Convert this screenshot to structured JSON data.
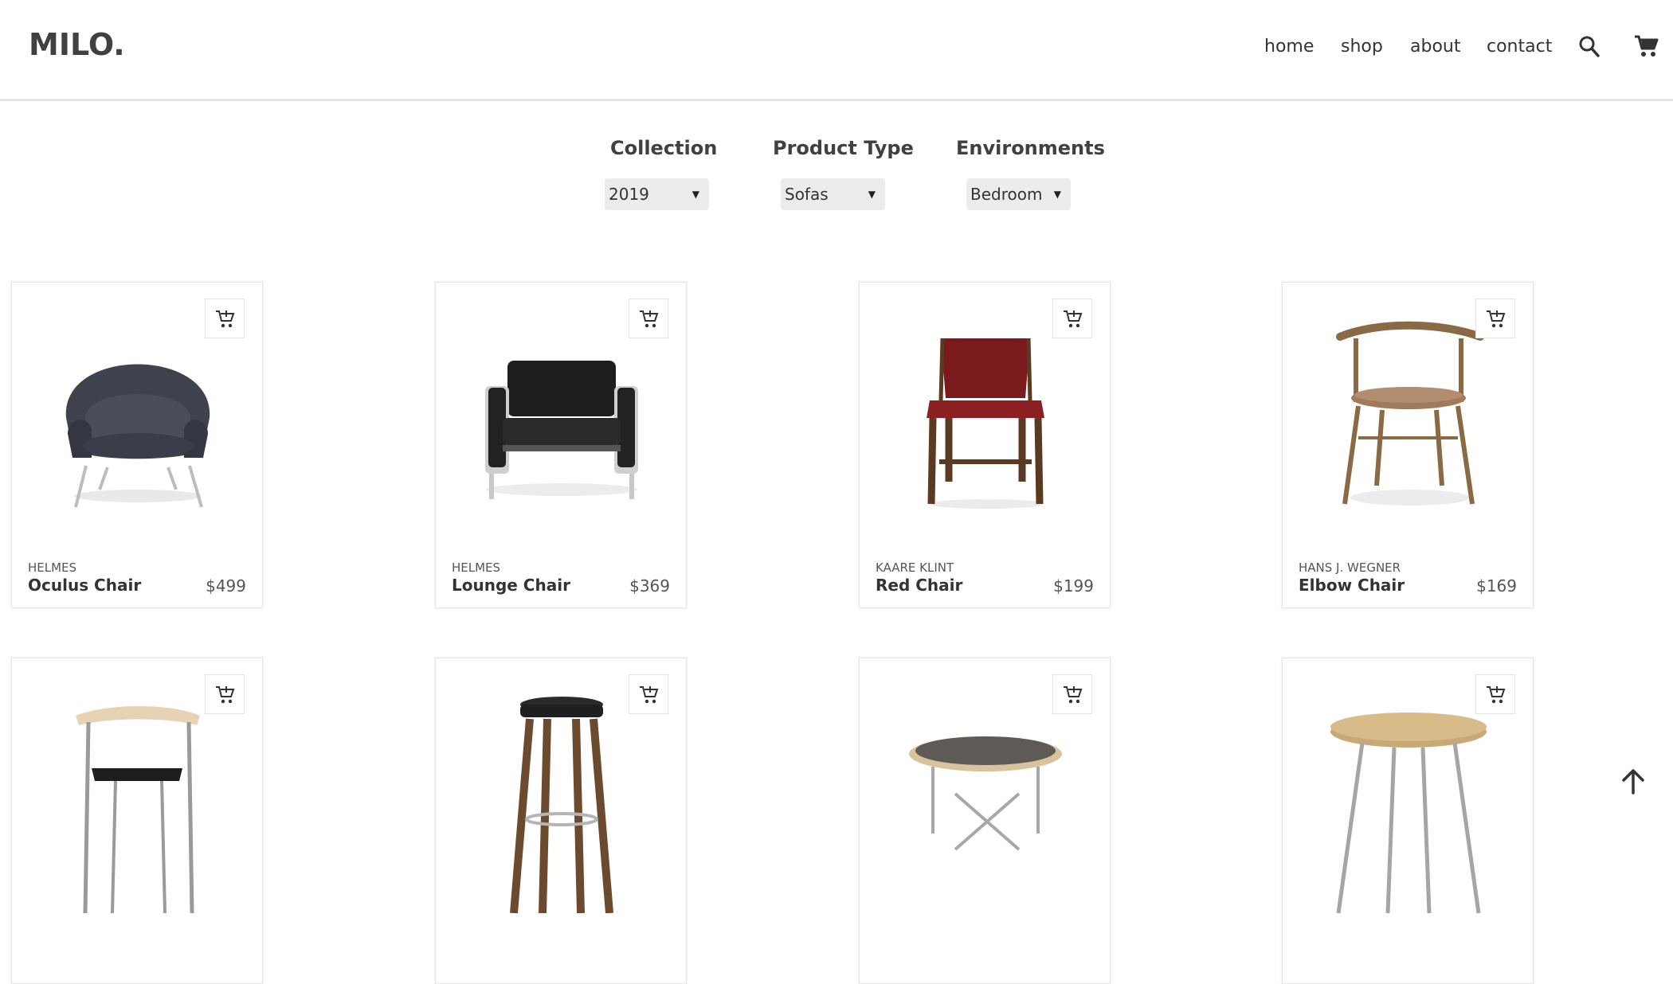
{
  "brand": {
    "logo": "MILO."
  },
  "nav": {
    "items": [
      "home",
      "shop",
      "about",
      "contact"
    ],
    "search_icon": "search-icon",
    "cart_icon": "cart-icon"
  },
  "filters": [
    {
      "label": "Collection",
      "value": "2019"
    },
    {
      "label": "Product Type",
      "value": "Sofas"
    },
    {
      "label": "Environments",
      "value": "Bedroom"
    }
  ],
  "products": [
    {
      "brand": "HELMES",
      "name": "Oculus Chair",
      "price": "$499"
    },
    {
      "brand": "HELMES",
      "name": "Lounge Chair",
      "price": "$369"
    },
    {
      "brand": "KAARE KLINT",
      "name": "Red Chair",
      "price": "$199"
    },
    {
      "brand": "HANS J. WEGNER",
      "name": "Elbow Chair",
      "price": "$169"
    },
    {
      "brand": "",
      "name": "",
      "price": ""
    },
    {
      "brand": "",
      "name": "",
      "price": ""
    },
    {
      "brand": "",
      "name": "",
      "price": ""
    },
    {
      "brand": "",
      "name": "",
      "price": ""
    }
  ],
  "icons": {
    "add_to_cart": "add-to-cart-icon",
    "scroll_top": "arrow-up-icon"
  },
  "colors": {
    "text": "#3f3f3f",
    "border": "#e6e6e6",
    "select_bg": "#ececec"
  }
}
